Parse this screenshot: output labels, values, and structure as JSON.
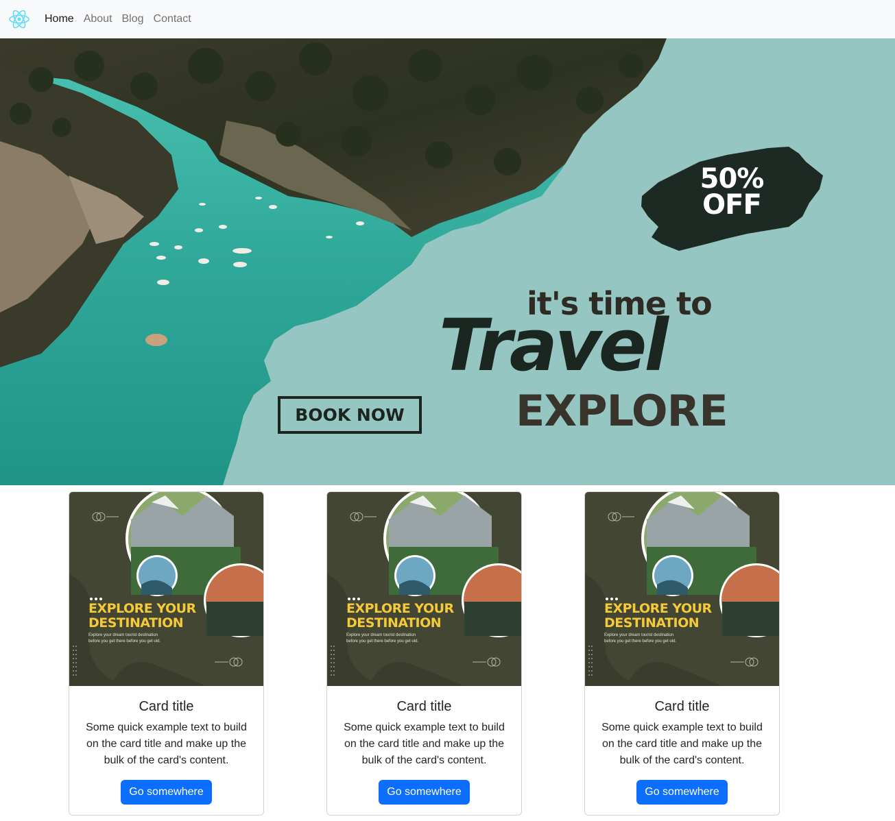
{
  "navbar": {
    "brand_icon": "react-atom-icon",
    "brand_color": "#61dafb",
    "links": [
      {
        "label": "Home",
        "active": true
      },
      {
        "label": "About",
        "active": false
      },
      {
        "label": "Blog",
        "active": false
      },
      {
        "label": "Contact",
        "active": false
      }
    ]
  },
  "hero": {
    "badge_line1": "50%",
    "badge_line2": "OFF",
    "tagline_small": "it's time to",
    "tagline_big": "Travel",
    "tagline_explore": "EXPLORE",
    "book_button": "BOOK NOW",
    "background_color": "#95c6c1",
    "water_color": "#3aaea0"
  },
  "cards": [
    {
      "poster_title_1": "EXPLORE YOUR",
      "poster_title_2": "DESTINATION",
      "poster_sub_1": "Explore your dream tourist destination",
      "poster_sub_2": "before you get there before you get old.",
      "title": "Card title",
      "text": "Some quick example text to build on the card title and make up the bulk of the card's content.",
      "button": "Go somewhere"
    },
    {
      "poster_title_1": "EXPLORE YOUR",
      "poster_title_2": "DESTINATION",
      "poster_sub_1": "Explore your dream tourist destination",
      "poster_sub_2": "before you get there before you get old.",
      "title": "Card title",
      "text": "Some quick example text to build on the card title and make up the bulk of the card's content.",
      "button": "Go somewhere"
    },
    {
      "poster_title_1": "EXPLORE YOUR",
      "poster_title_2": "DESTINATION",
      "poster_sub_1": "Explore your dream tourist destination",
      "poster_sub_2": "before you get there before you get old.",
      "title": "Card title",
      "text": "Some quick example text to build on the card title and make up the bulk of the card's content.",
      "button": "Go somewhere"
    }
  ]
}
